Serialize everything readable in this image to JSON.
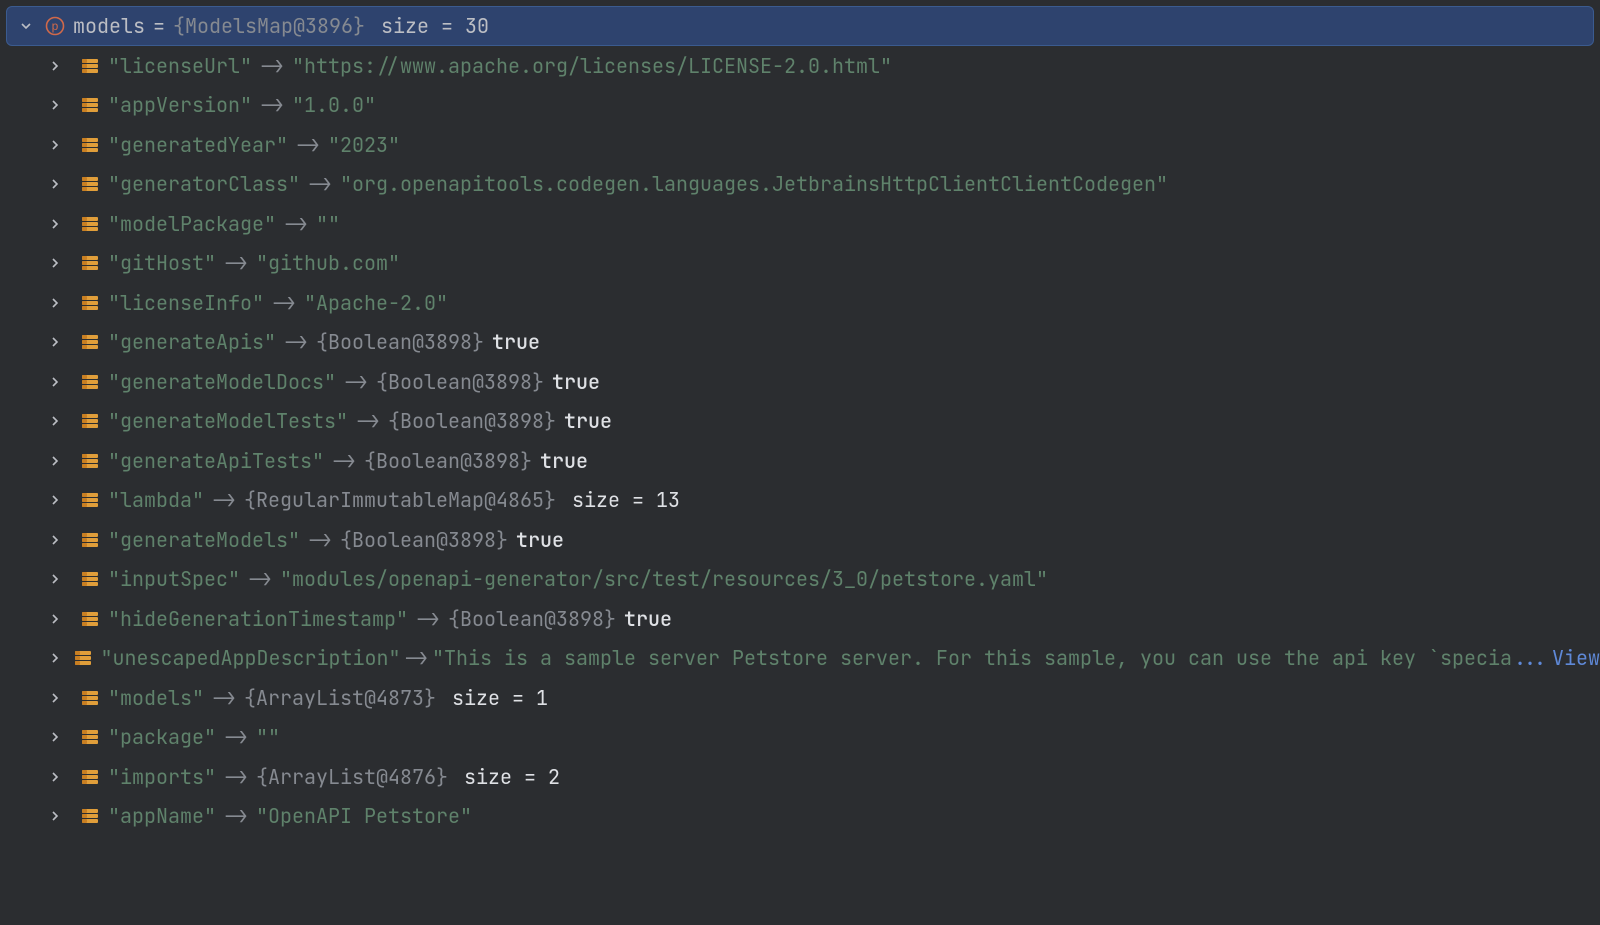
{
  "root": {
    "name": "models",
    "eq": "=",
    "type": "{ModelsMap@3896}",
    "size": "size = 30"
  },
  "arrow": "->",
  "true_label": "true",
  "ellipsis": "...",
  "view": "View",
  "entries": [
    {
      "key": "\"licenseUrl\"",
      "kind": "str",
      "val": "\"https://www.apache.org/licenses/LICENSE-2.0.html\""
    },
    {
      "key": "\"appVersion\"",
      "kind": "str",
      "val": "\"1.0.0\""
    },
    {
      "key": "\"generatedYear\"",
      "kind": "str",
      "val": "\"2023\""
    },
    {
      "key": "\"generatorClass\"",
      "kind": "str",
      "val": "\"org.openapitools.codegen.languages.JetbrainsHttpClientClientCodegen\""
    },
    {
      "key": "\"modelPackage\"",
      "kind": "str",
      "val": "\"\""
    },
    {
      "key": "\"gitHost\"",
      "kind": "str",
      "val": "\"github.com\""
    },
    {
      "key": "\"licenseInfo\"",
      "kind": "str",
      "val": "\"Apache-2.0\""
    },
    {
      "key": "\"generateApis\"",
      "kind": "bool",
      "obj": "{Boolean@3898}"
    },
    {
      "key": "\"generateModelDocs\"",
      "kind": "bool",
      "obj": "{Boolean@3898}"
    },
    {
      "key": "\"generateModelTests\"",
      "kind": "bool",
      "obj": "{Boolean@3898}"
    },
    {
      "key": "\"generateApiTests\"",
      "kind": "bool",
      "obj": "{Boolean@3898}"
    },
    {
      "key": "\"lambda\"",
      "kind": "size",
      "obj": "{RegularImmutableMap@4865}",
      "size": "size = 13"
    },
    {
      "key": "\"generateModels\"",
      "kind": "bool",
      "obj": "{Boolean@3898}"
    },
    {
      "key": "\"inputSpec\"",
      "kind": "str",
      "val": "\"modules/openapi-generator/src/test/resources/3_0/petstore.yaml\""
    },
    {
      "key": "\"hideGenerationTimestamp\"",
      "kind": "bool",
      "obj": "{Boolean@3898}"
    },
    {
      "key": "\"unescapedAppDescription\"",
      "kind": "trunc",
      "val": "\"This is a sample server Petstore server. For this sample, you can use the api key `specia"
    },
    {
      "key": "\"models\"",
      "kind": "size",
      "obj": "{ArrayList@4873}",
      "size": "size = 1"
    },
    {
      "key": "\"package\"",
      "kind": "str",
      "val": "\"\""
    },
    {
      "key": "\"imports\"",
      "kind": "size",
      "obj": "{ArrayList@4876}",
      "size": "size = 2"
    },
    {
      "key": "\"appName\"",
      "kind": "str",
      "val": "\"OpenAPI Petstore\""
    }
  ]
}
